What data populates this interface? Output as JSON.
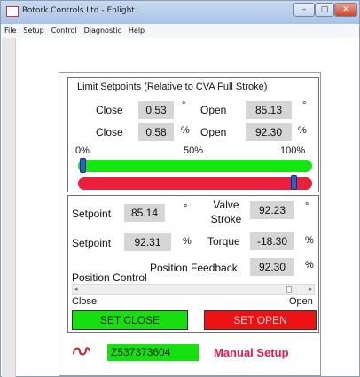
{
  "window": {
    "title": "Rotork Controls Ltd - Enlight.",
    "controls": {
      "minimize": "–",
      "maximize": "□",
      "close": "✕"
    }
  },
  "menu": [
    "File",
    "Setup",
    "Control",
    "Diagnostic",
    "Help"
  ],
  "limits": {
    "heading": "Limit Setpoints (Relative to CVA Full Stroke)",
    "close_label": "Close",
    "open_label": "Open",
    "close_deg": "0.53",
    "open_deg": "85.13",
    "close_pct": "0.58",
    "open_pct": "92.30",
    "deg_unit": "°",
    "pct_unit": "%",
    "scale": [
      "0%",
      "50%",
      "100%"
    ],
    "green_slider_level": 0.02,
    "red_slider_level": 0.92
  },
  "position": {
    "setpoint_label": "Setpoint",
    "setpoint_deg": "85.14",
    "setpoint_pct": "92.31",
    "valve_stroke_label": [
      "Valve",
      "Stroke"
    ],
    "valve_stroke": "92.23",
    "torque_label": "Torque",
    "torque": "-18.30",
    "feedback_label": "Position Feedback",
    "feedback": "92.30",
    "control_label": "Position Control",
    "close_text": "Close",
    "open_text": "Open",
    "scroll_level": 0.92,
    "set_close": "SET CLOSE",
    "set_open": "SET OPEN"
  },
  "footer": {
    "serial": "Z537373604",
    "mode": "Manual Setup"
  },
  "colors": {
    "green": "#17e010",
    "red": "#ee1212",
    "accent": "#e5194a"
  }
}
